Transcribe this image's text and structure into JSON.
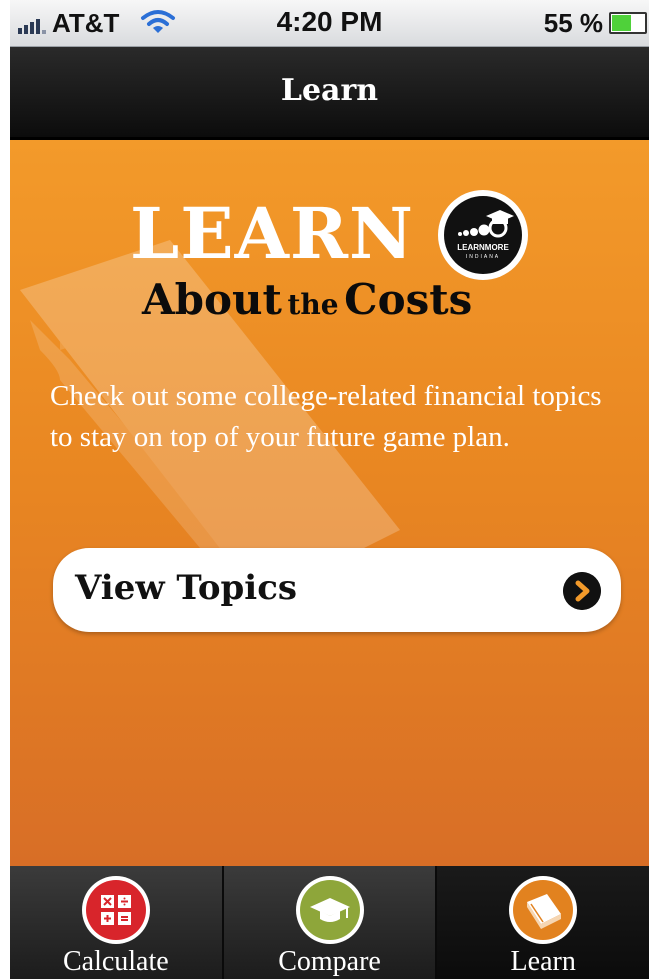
{
  "status_bar": {
    "carrier": "AT&T",
    "time": "4:20 PM",
    "battery": "55 %",
    "icons": [
      "signal-icon",
      "wifi-icon",
      "battery-icon"
    ]
  },
  "nav": {
    "title": "Learn"
  },
  "hero": {
    "title": "LEARN",
    "subtitle_about": "About",
    "subtitle_the": "the",
    "subtitle_costs": "Costs",
    "badge_name": "LEARNMORE",
    "badge_sub": "INDIANA",
    "description": "Check out some college-related financial topics to stay on top of your future game plan.",
    "button_label": "View Topics"
  },
  "tabs": [
    {
      "label": "Calculate",
      "icon": "calculator-icon",
      "color": "#d8252b",
      "selected": false
    },
    {
      "label": "Compare",
      "icon": "graduation-cap-icon",
      "color": "#8ea63a",
      "selected": false
    },
    {
      "label": "Learn",
      "icon": "book-icon",
      "color": "#e2821f",
      "selected": true
    }
  ],
  "colors": {
    "accent_orange": "#ef8f26",
    "nav_bg": "#111111",
    "button_bg": "#ffffff"
  }
}
